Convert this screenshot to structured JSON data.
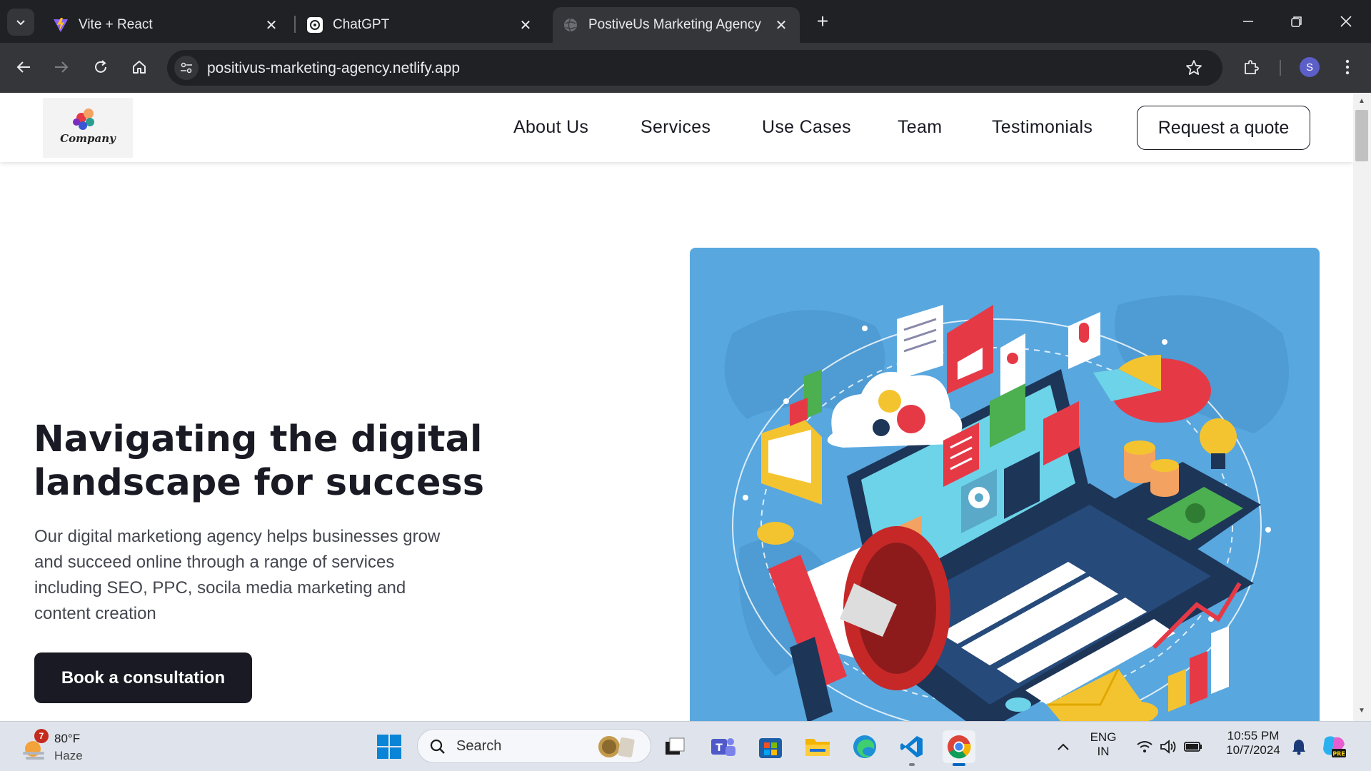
{
  "browser": {
    "tabs": [
      {
        "title": "Vite + React",
        "active": false,
        "favicon": "vite-logo-icon"
      },
      {
        "title": "ChatGPT",
        "active": false,
        "favicon": "chatgpt-logo-icon"
      },
      {
        "title": "PostiveUs Marketing Agency",
        "active": true,
        "favicon": "globe-icon"
      }
    ],
    "url": "positivus-marketing-agency.netlify.app",
    "profile_initial": "S"
  },
  "site": {
    "logo_text": "Company",
    "nav": {
      "about": "About Us",
      "services": "Services",
      "use_cases": "Use Cases",
      "team": "Team",
      "testimonials": "Testimonials",
      "quote_button": "Request a quote"
    },
    "hero": {
      "title_line1": "Navigating the digital",
      "title_line2": "landscape for success",
      "description": "Our digital marketiong agency helps businesses grow and succeed online through a range of services including SEO, PPC, socila media marketing and content creation",
      "cta": "Book a consultation"
    }
  },
  "taskbar": {
    "weather_temp": "80°F",
    "weather_cond": "Haze",
    "weather_badge": "7",
    "search_label": "Search",
    "lang_line1": "ENG",
    "lang_line2": "IN",
    "time": "10:55 PM",
    "date": "10/7/2024"
  },
  "colors": {
    "tab_bar": "#202124",
    "toolbar": "#35363a",
    "text_dark": "#191a23",
    "hero_illustration_bg": "#58a7df",
    "taskbar": "#dfe4ec"
  }
}
